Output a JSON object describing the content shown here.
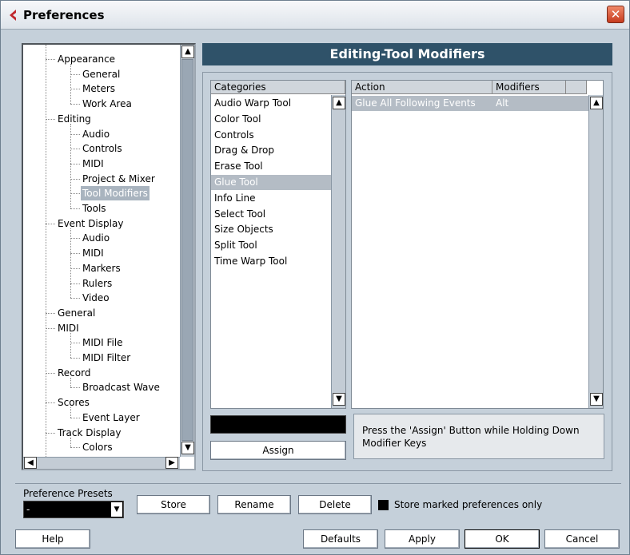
{
  "window": {
    "title": "Preferences",
    "close_label": "✕"
  },
  "tree": {
    "items": [
      {
        "label": "Appearance",
        "level": 0
      },
      {
        "label": "General",
        "level": 1
      },
      {
        "label": "Meters",
        "level": 1
      },
      {
        "label": "Work Area",
        "level": 1
      },
      {
        "label": "Editing",
        "level": 0
      },
      {
        "label": "Audio",
        "level": 1
      },
      {
        "label": "Controls",
        "level": 1
      },
      {
        "label": "MIDI",
        "level": 1
      },
      {
        "label": "Project & Mixer",
        "level": 1
      },
      {
        "label": "Tool Modifiers",
        "level": 1,
        "selected": true
      },
      {
        "label": "Tools",
        "level": 1
      },
      {
        "label": "Event Display",
        "level": 0
      },
      {
        "label": "Audio",
        "level": 1
      },
      {
        "label": "MIDI",
        "level": 1
      },
      {
        "label": "Markers",
        "level": 1
      },
      {
        "label": "Rulers",
        "level": 1
      },
      {
        "label": "Video",
        "level": 1
      },
      {
        "label": "General",
        "level": 0
      },
      {
        "label": "MIDI",
        "level": 0
      },
      {
        "label": "MIDI File",
        "level": 1
      },
      {
        "label": "MIDI Filter",
        "level": 1
      },
      {
        "label": "Record",
        "level": 0
      },
      {
        "label": "Broadcast Wave",
        "level": 1
      },
      {
        "label": "Scores",
        "level": 0
      },
      {
        "label": "Event Layer",
        "level": 1
      },
      {
        "label": "Track Display",
        "level": 0
      },
      {
        "label": "Colors",
        "level": 1
      }
    ]
  },
  "page": {
    "heading": "Editing-Tool Modifiers"
  },
  "categories": {
    "header": "Categories",
    "items": [
      "Audio Warp Tool",
      "Color Tool",
      "Controls",
      "Drag & Drop",
      "Erase Tool",
      "Glue Tool",
      "Info Line",
      "Select Tool",
      "Size Objects",
      "Split Tool",
      "Time Warp Tool"
    ],
    "selected_index": 5
  },
  "actions": {
    "columns": [
      "Action",
      "Modifiers"
    ],
    "rows": [
      {
        "action": "Glue All Following Events",
        "modifiers": "Alt"
      }
    ]
  },
  "assign": {
    "label": "Assign",
    "key_value": ""
  },
  "hint": "Press the 'Assign' Button while Holding Down Modifier Keys",
  "presets": {
    "label": "Preference Presets",
    "selected": "-",
    "store_label": "Store",
    "rename_label": "Rename",
    "delete_label": "Delete",
    "store_marked_label": "Store marked preferences only"
  },
  "footer": {
    "help": "Help",
    "defaults": "Defaults",
    "apply": "Apply",
    "ok": "OK",
    "cancel": "Cancel"
  },
  "colors": {
    "header_bg": "#2f5269",
    "window_bg": "#c5d0da",
    "selection": "#a9b4bf"
  }
}
